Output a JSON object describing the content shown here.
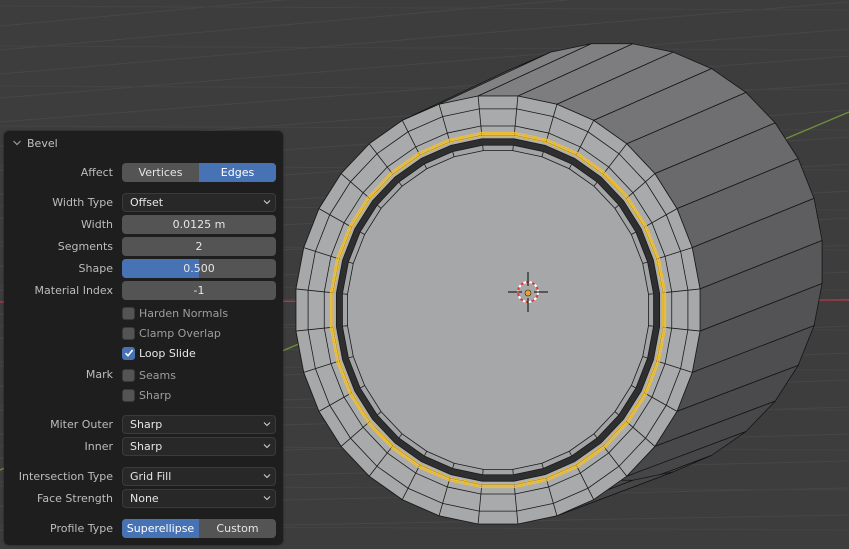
{
  "viewport": {
    "background": "#3d3d3d",
    "selection_color": "#f3c12a",
    "axis_x_color": "#b33c46",
    "axis_y_color": "#6b8f3a",
    "cursor": "3d-cursor-icon",
    "origin": "object-origin-dot"
  },
  "panel": {
    "title": "Bevel",
    "collapse_icon": "chevron-down-icon",
    "affect": {
      "label": "Affect",
      "options": [
        "Vertices",
        "Edges"
      ],
      "selected": "Edges"
    },
    "width_type": {
      "label": "Width Type",
      "value": "Offset"
    },
    "width": {
      "label": "Width",
      "value": "0.0125 m"
    },
    "segments": {
      "label": "Segments",
      "value": "2"
    },
    "shape": {
      "label": "Shape",
      "value": "0.500",
      "fraction": 0.5
    },
    "material_index": {
      "label": "Material Index",
      "value": "-1"
    },
    "harden_normals": {
      "label": "Harden Normals",
      "checked": false
    },
    "clamp_overlap": {
      "label": "Clamp Overlap",
      "checked": false
    },
    "loop_slide": {
      "label": "Loop Slide",
      "checked": true
    },
    "mark": {
      "label": "Mark",
      "seams": {
        "label": "Seams",
        "checked": false
      },
      "sharp": {
        "label": "Sharp",
        "checked": false
      }
    },
    "miter_outer": {
      "label": "Miter Outer",
      "value": "Sharp"
    },
    "miter_inner": {
      "label": "Inner",
      "value": "Sharp"
    },
    "intersection_type": {
      "label": "Intersection Type",
      "value": "Grid Fill"
    },
    "face_strength": {
      "label": "Face Strength",
      "value": "None"
    },
    "profile_type": {
      "label": "Profile Type",
      "options": [
        "Superellipse",
        "Custom"
      ],
      "selected": "Superellipse"
    }
  }
}
